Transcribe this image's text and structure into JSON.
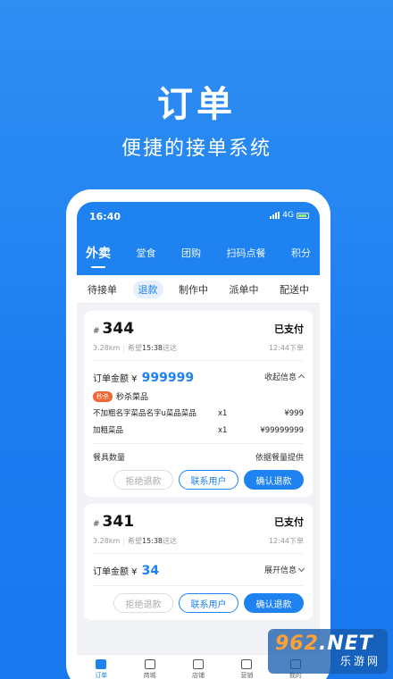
{
  "promo": {
    "title": "订单",
    "subtitle": "便捷的接单系统"
  },
  "status": {
    "time": "16:40",
    "network": "4G"
  },
  "top_tabs": [
    "外卖",
    "堂食",
    "团购",
    "扫码点餐",
    "积分"
  ],
  "sub_tabs": [
    "待接单",
    "退款",
    "制作中",
    "派单中",
    "配送中"
  ],
  "orders": [
    {
      "hash": "#",
      "number": "344",
      "status": "已支付",
      "distance": "3.28km",
      "expect_prefix": "希望",
      "expect_time": "15:38",
      "expect_suffix": "送达",
      "placed": "12:44下单",
      "amount_label": "订单金额 ¥",
      "amount": "999999",
      "toggle": "收起信息",
      "flash_badge": "秒杀",
      "flash_label": "秒杀菜品",
      "items": [
        {
          "name": "不加粗名字菜品名字u菜品菜品",
          "qty": "x1",
          "price": "¥999"
        },
        {
          "name": "加粗菜品",
          "qty": "x1",
          "price": "¥99999999"
        }
      ],
      "tableware_label": "餐具数量",
      "tableware_value": "依据餐量提供",
      "btn_reject": "拒绝退款",
      "btn_contact": "联系用户",
      "btn_confirm": "确认退款"
    },
    {
      "hash": "#",
      "number": "341",
      "status": "已支付",
      "distance": "3.28km",
      "expect_prefix": "希望",
      "expect_time": "15:38",
      "expect_suffix": "送达",
      "placed": "12:44下单",
      "amount_label": "订单金额 ¥",
      "amount": "34",
      "toggle": "展开信息",
      "btn_reject": "拒绝退款",
      "btn_contact": "联系用户",
      "btn_confirm": "确认退款"
    }
  ],
  "tabbar": [
    "订单",
    "商城",
    "店铺",
    "营销",
    "我的"
  ],
  "watermark": {
    "top_a": "962",
    "top_b": ".NET",
    "bottom": "乐游网"
  },
  "colors": {
    "brand": "#1e82f1",
    "flash": "#f06533"
  }
}
